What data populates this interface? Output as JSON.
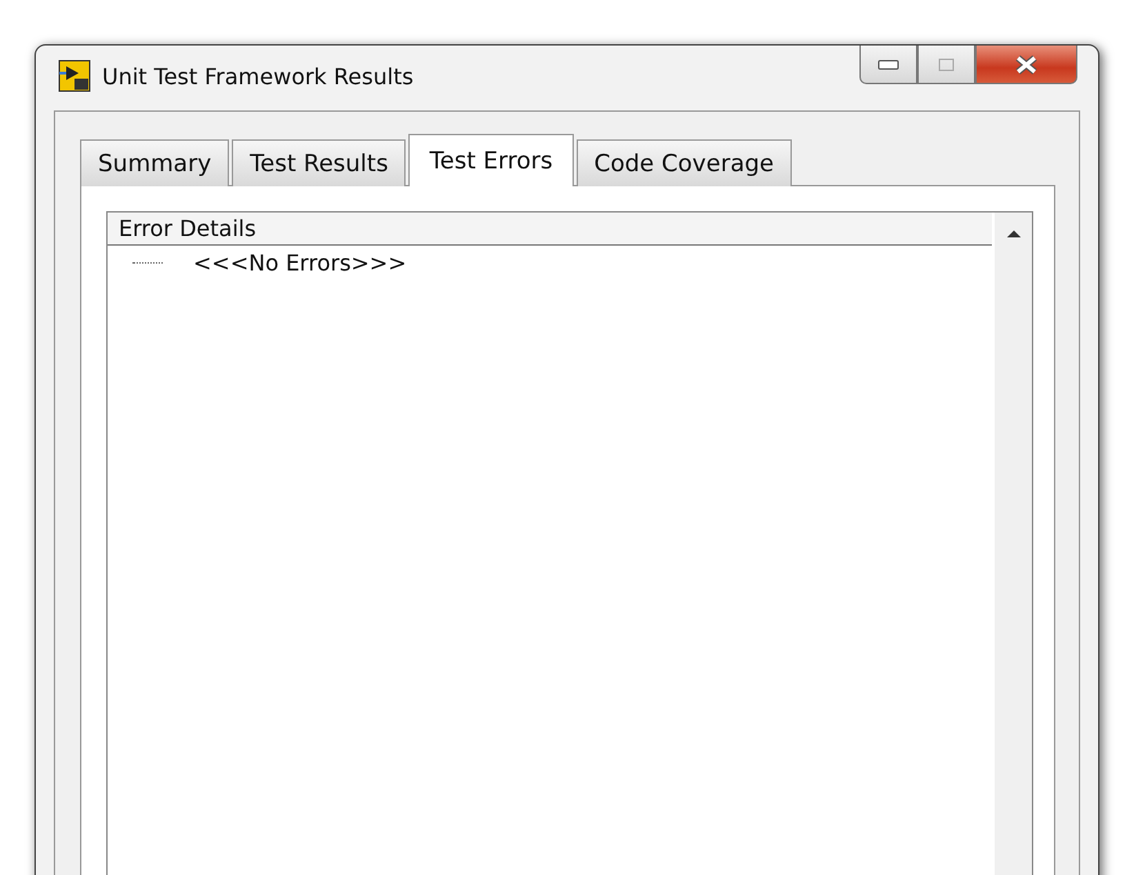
{
  "window": {
    "title": "Unit Test Framework Results"
  },
  "tabs": [
    {
      "label": "Summary",
      "selected": false
    },
    {
      "label": "Test Results",
      "selected": false
    },
    {
      "label": "Test Errors",
      "selected": true
    },
    {
      "label": "Code Coverage",
      "selected": false
    }
  ],
  "tree": {
    "column": "Error Details",
    "items": [
      {
        "label": "<<<No Errors>>>"
      }
    ]
  }
}
